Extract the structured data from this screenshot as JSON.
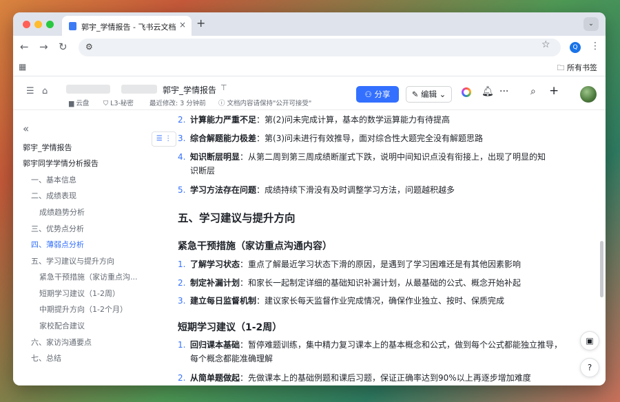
{
  "browser": {
    "tab_title": "郭宇_学情报告 - 飞书云文档",
    "tab_close": "×",
    "new_tab": "+",
    "bookmarks_folder": "所有书签",
    "url": "",
    "profile_letter": "Q"
  },
  "header": {
    "doc_title": "郭宇_学情报告",
    "location": "云盘",
    "security": "L3-秘密",
    "last_modified": "最近修改: 3 分钟前",
    "access_note": "文档内容请保持\"公开可接受\"",
    "share_label": "分享",
    "edit_label": "编辑"
  },
  "toc": {
    "items": [
      {
        "label": "郭宇_学情报告",
        "level": 0
      },
      {
        "label": "郭宇同学学情分析报告",
        "level": 0
      },
      {
        "label": "一、基本信息",
        "level": 1
      },
      {
        "label": "二、成绩表现",
        "level": 1
      },
      {
        "label": "成绩趋势分析",
        "level": 2
      },
      {
        "label": "三、优势点分析",
        "level": 1
      },
      {
        "label": "四、薄弱点分析",
        "level": 1,
        "active": true
      },
      {
        "label": "五、学习建议与提升方向",
        "level": 1
      },
      {
        "label": "紧急干预措施（家访重点沟...",
        "level": 2
      },
      {
        "label": "短期学习建议（1-2周）",
        "level": 2
      },
      {
        "label": "中期提升方向（1-2个月）",
        "level": 2
      },
      {
        "label": "家校配合建议",
        "level": 2
      },
      {
        "label": "六、家访沟通要点",
        "level": 1
      },
      {
        "label": "七、总结",
        "level": 1
      }
    ]
  },
  "content": {
    "weak_points": [
      {
        "num": "2.",
        "bold": "计算能力严重不足",
        "text": "：第(2)问未完成计算，基本的数学运算能力有待提高"
      },
      {
        "num": "3.",
        "bold": "综合解题能力极差",
        "text": "：第(3)问未进行有效推导，面对综合性大题完全没有解题思路"
      },
      {
        "num": "4.",
        "bold": "知识断层明显",
        "text": "：从第二周到第三周成绩断崖式下跌，说明中间知识点没有衔接上，出现了明显的知识断层"
      },
      {
        "num": "5.",
        "bold": "学习方法存在问题",
        "text": "：成绩持续下滑没有及时调整学习方法，问题越积越多"
      }
    ],
    "section5_title": "五、学习建议与提升方向",
    "urgent_title": "紧急干预措施（家访重点沟通内容）",
    "urgent_items": [
      {
        "num": "1.",
        "bold": "了解学习状态",
        "text": "：重点了解最近学习状态下滑的原因，是遇到了学习困难还是有其他因素影响"
      },
      {
        "num": "2.",
        "bold": "制定补漏计划",
        "text": "：和家长一起制定详细的基础知识补漏计划，从最基础的公式、概念开始补起"
      },
      {
        "num": "3.",
        "bold": "建立每日监督机制",
        "text": "：建议家长每天监督作业完成情况，确保作业独立、按时、保质完成"
      }
    ],
    "short_title": "短期学习建议（1-2周）",
    "short_items": [
      {
        "num": "1.",
        "bold": "回归课本基础",
        "text": "：暂停难题训练，集中精力复习课本上的基本概念和公式，做到每个公式都能独立推导，每个概念都能准确理解"
      },
      {
        "num": "2.",
        "bold": "从简单题做起",
        "text": "：先做课本上的基础例题和课后习题，保证正确率达到90%以上再逐步增加难度"
      }
    ]
  },
  "colors": {
    "accent": "#3370ff",
    "text": "#1f2329",
    "muted": "#646a73"
  }
}
